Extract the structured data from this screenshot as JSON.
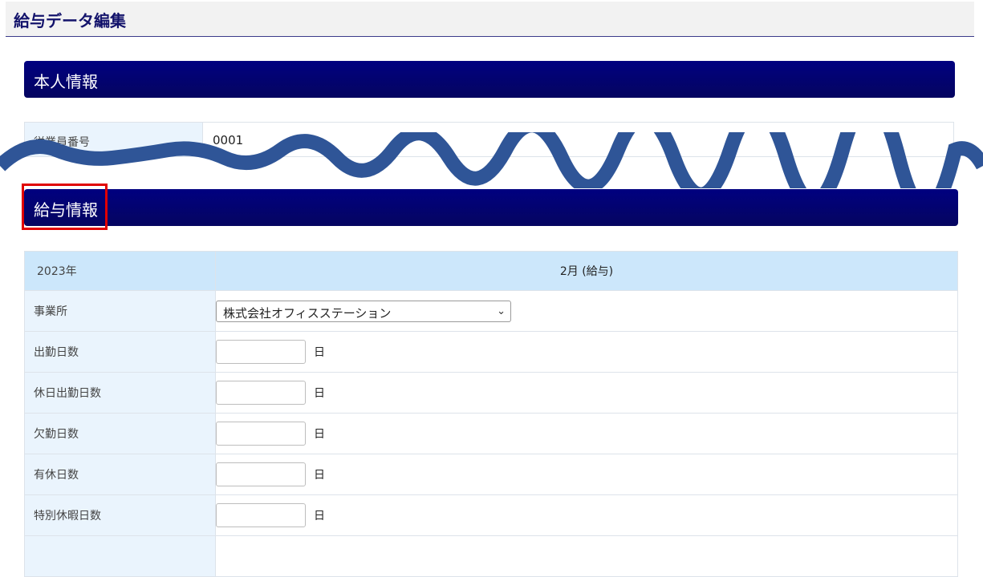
{
  "page": {
    "title": "給与データ編集"
  },
  "personal_section": {
    "title": "本人情報",
    "employee_number_label": "従業員番号",
    "employee_number_value": "0001"
  },
  "salary_section": {
    "title": "給与情報",
    "year": "2023年",
    "month": "2月 (給与)",
    "office": {
      "label": "事業所",
      "selected": "株式会社オフィスステーション"
    },
    "rows": [
      {
        "label": "出勤日数",
        "value": "",
        "unit": "日"
      },
      {
        "label": "休日出勤日数",
        "value": "",
        "unit": "日"
      },
      {
        "label": "欠勤日数",
        "value": "",
        "unit": "日"
      },
      {
        "label": "有休日数",
        "value": "",
        "unit": "日"
      },
      {
        "label": "特別休暇日数",
        "value": "",
        "unit": "日"
      }
    ]
  },
  "colors": {
    "section_bar": "#000080",
    "label_bg": "#eaf4fd",
    "header_row_bg": "#cce7fb",
    "wave": "#2f5597",
    "highlight": "#e00000"
  }
}
